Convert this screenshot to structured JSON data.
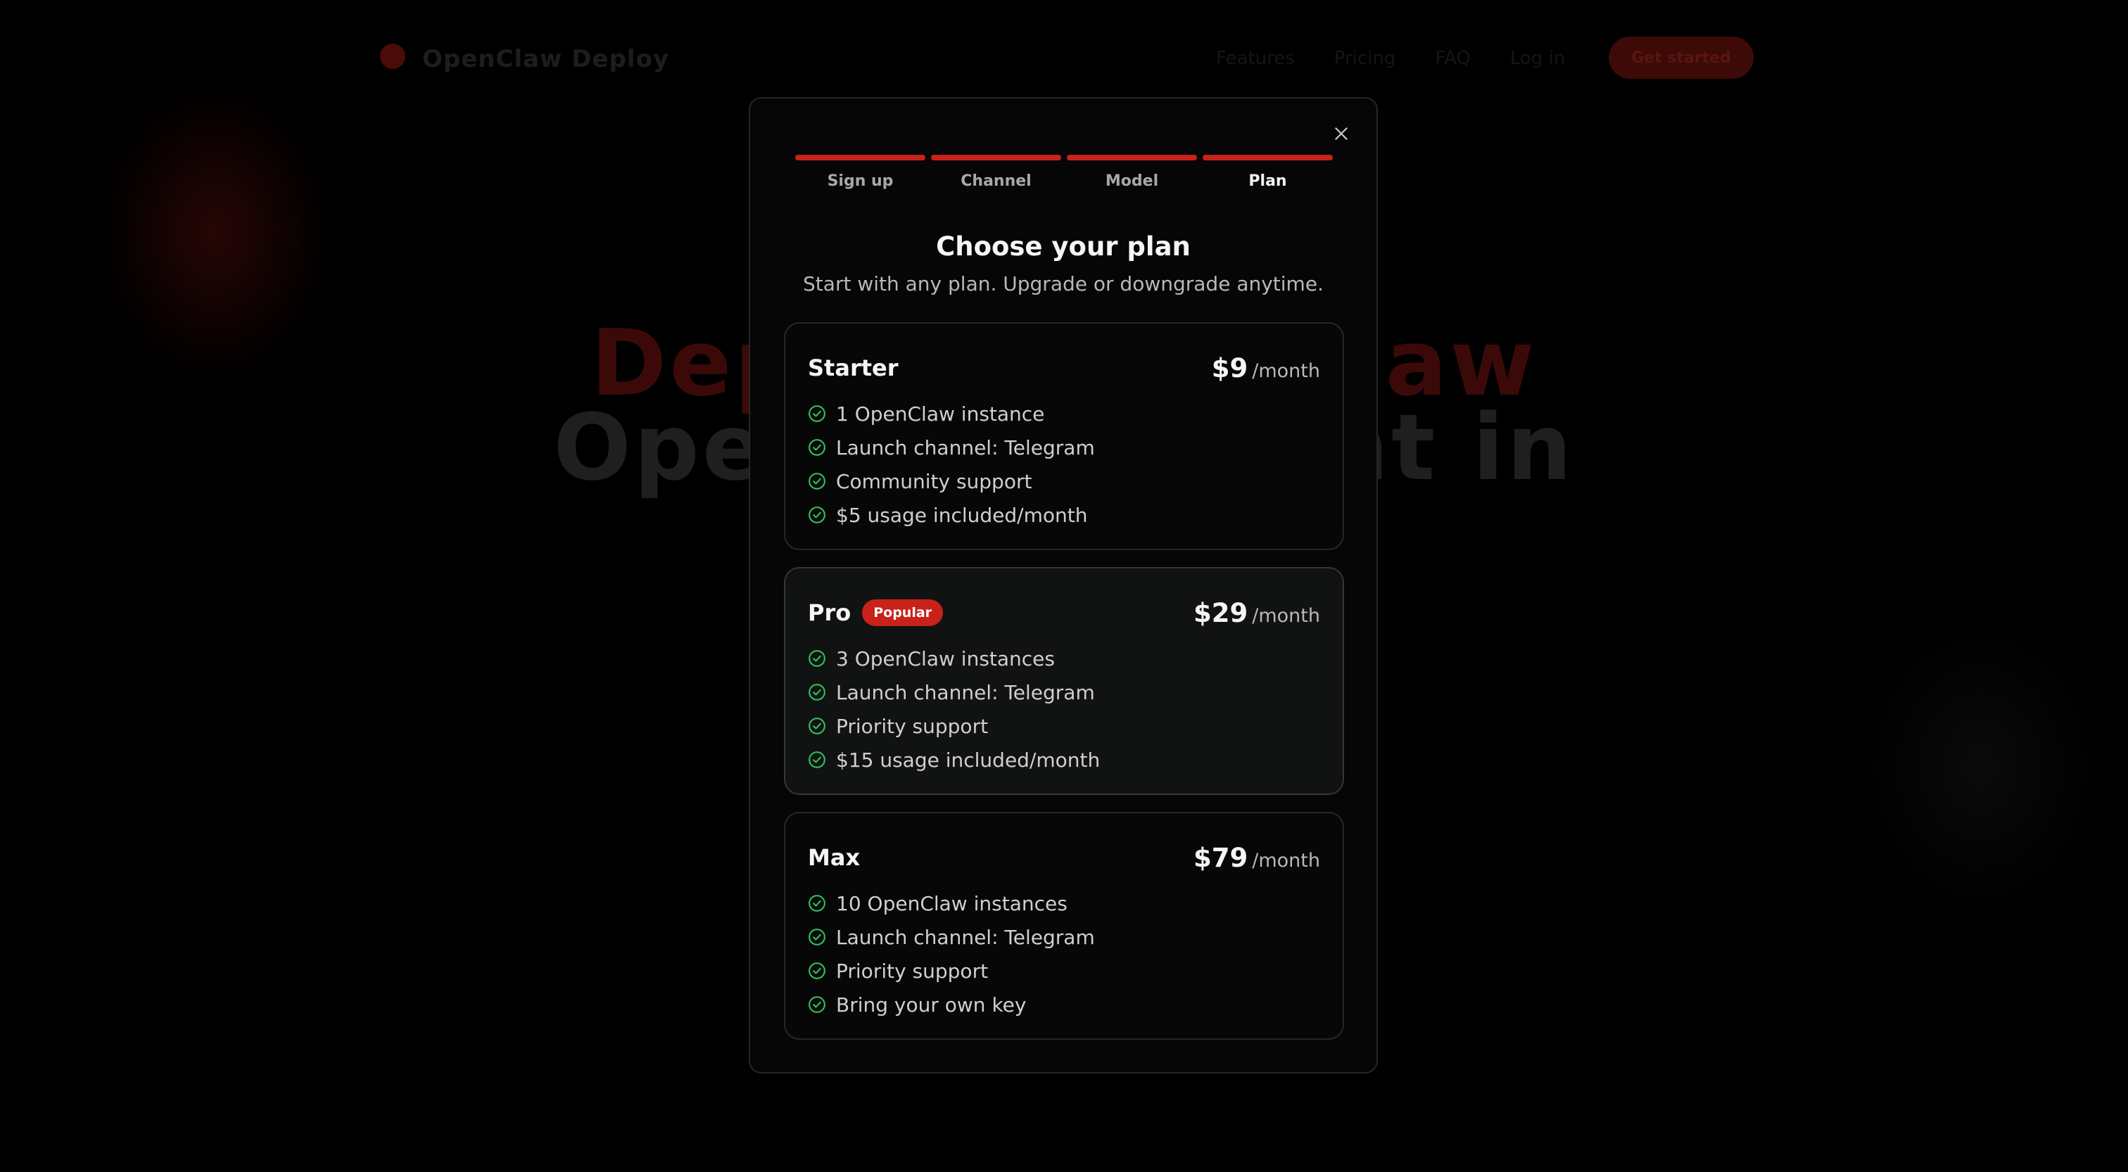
{
  "background_site": {
    "brand": "OpenClaw Deploy",
    "nav_links": [
      "Features",
      "Pricing",
      "FAQ",
      "Log in"
    ],
    "cta_label": "Get started"
  },
  "wizard": {
    "steps": [
      {
        "label": "Sign up",
        "completed": true
      },
      {
        "label": "Channel",
        "completed": true
      },
      {
        "label": "Model",
        "completed": true
      },
      {
        "label": "Plan",
        "completed": true,
        "current": true
      }
    ],
    "title": "Choose your plan",
    "subtitle": "Start with any plan. Upgrade or downgrade anytime.",
    "close_icon": "close-icon"
  },
  "plans": [
    {
      "name": "Starter",
      "badge": "",
      "price": "$9",
      "period": "/month",
      "features": [
        "1 OpenClaw instance",
        "Launch channel: Telegram",
        "Community support",
        "$5 usage included/month"
      ]
    },
    {
      "name": "Pro",
      "badge": "Popular",
      "price": "$29",
      "period": "/month",
      "features": [
        "3 OpenClaw instances",
        "Launch channel: Telegram",
        "Priority support",
        "$15 usage included/month"
      ]
    },
    {
      "name": "Max",
      "badge": "",
      "price": "$79",
      "period": "/month",
      "features": [
        "10 OpenClaw instances",
        "Launch channel: Telegram",
        "Priority support",
        "Bring your own key"
      ]
    }
  ],
  "colors": {
    "accent": "#c8221b",
    "check": "#2fbf5a",
    "background": "#000000",
    "modal": "#060606"
  }
}
